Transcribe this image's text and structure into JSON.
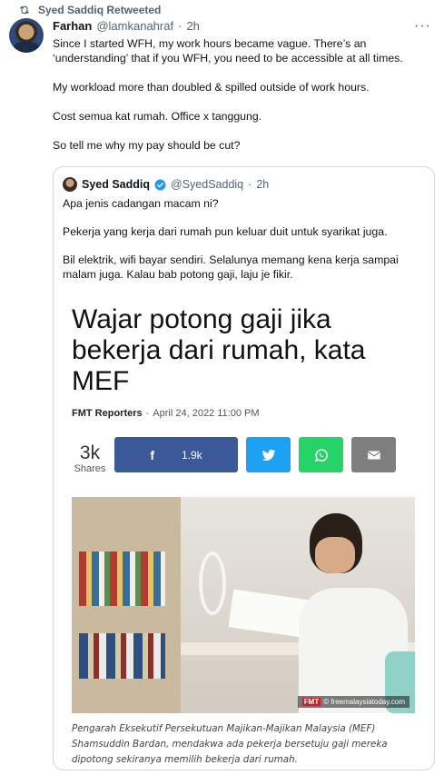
{
  "retweet": {
    "label": "Syed Saddiq Retweeted",
    "icon": "retweet-icon"
  },
  "tweet": {
    "author_name": "Farhan",
    "handle": "@lamkanahraf",
    "separator": "·",
    "time": "2h",
    "more_icon": "more-dots-icon",
    "paragraphs": [
      "Since I started WFH, my work hours became vague. There’s an ‘understanding’ that if you WFH, you need to be accessible at all times.",
      "My workload more than doubled & spilled outside of work hours.",
      "Cost semua kat rumah. Office x tanggung.",
      "So tell me why my pay should be cut?"
    ]
  },
  "quote": {
    "author_name": "Syed Saddiq",
    "verified_icon": "verified-badge-icon",
    "handle": "@SyedSaddiq",
    "separator": "·",
    "time": "2h",
    "paragraphs": [
      "Apa jenis cadangan macam ni?",
      "Pekerja yang kerja dari rumah pun keluar duit untuk syarikat juga.",
      "Bil elektrik, wifi bayar sendiri. Selalunya memang kena kerja sampai malam juga. Kalau bab potong gaji, laju je fikir."
    ]
  },
  "article": {
    "headline": "Wajar potong gaji jika bekerja dari rumah, kata MEF",
    "author": "FMT Reporters",
    "dash": "-",
    "date": "April 24, 2022 11:00 PM",
    "shares_count": "3k",
    "shares_label": "Shares",
    "facebook_glyph": "f",
    "facebook_count": "1.9k",
    "photo_credit_brand": "FMT",
    "photo_credit": "© freemalaysiatoday.com",
    "caption": "Pengarah Eksekutif Persekutuan Majikan-Majikan Malaysia (MEF) Shamsuddin Bardan, mendakwa ada pekerja bersetuju gaji mereka dipotong sekiranya memilih bekerja dari rumah.",
    "colors": {
      "facebook": "#3b5998",
      "twitter": "#1da1f2",
      "whatsapp": "#25d366",
      "email": "#7f7f7f"
    }
  }
}
